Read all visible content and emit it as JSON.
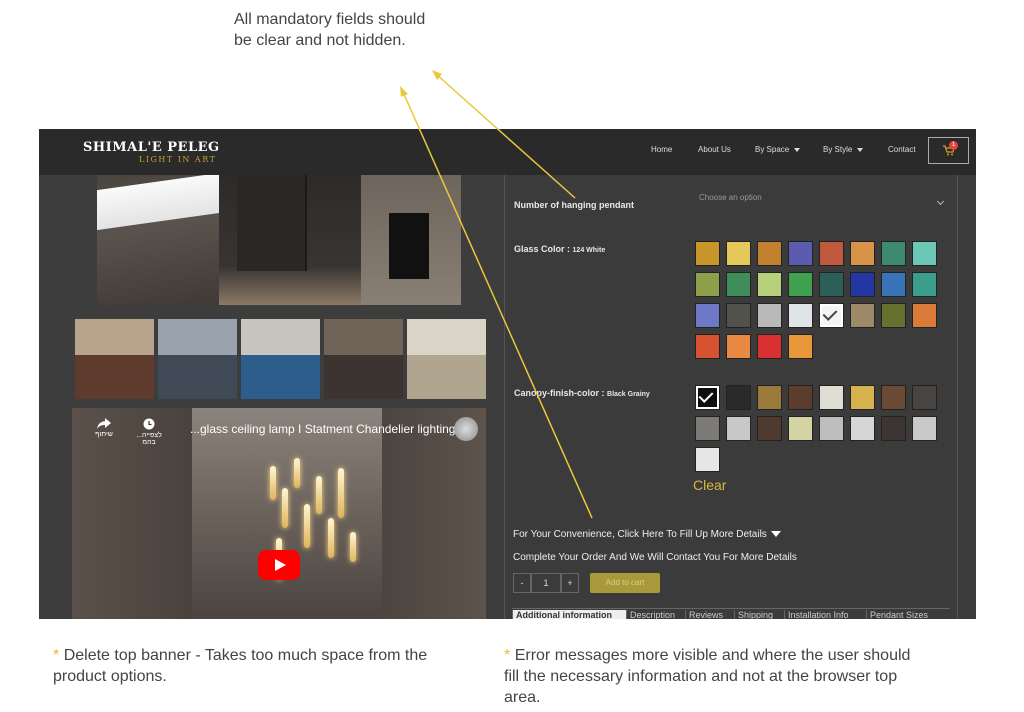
{
  "annotations": {
    "top_note": "All mandatory fields should be clear and not hidden.",
    "bottom_left_star": "*",
    "bottom_left_note": "Delete top banner - Takes too much space from the product options.",
    "bottom_right_star": "*",
    "bottom_right_note": "Error messages more visible and where the user should fill the necessary information and not at the browser top area."
  },
  "header": {
    "logo_main": "SHIMAL'E PELEG",
    "logo_sub": "LIGHT IN ART",
    "nav": [
      "Home",
      "About Us",
      "By Space",
      "By Style",
      "Contact"
    ],
    "cart_count": "1",
    "cart_icon": "shopping-cart-icon"
  },
  "video": {
    "share_label": "שיתוף",
    "watch_later_label": "...לצפייה בהמ",
    "title": "...glass ceiling lamp I Statment Chandelier lighting"
  },
  "options": {
    "pendant_label": "Number of hanging pendant",
    "pendant_placeholder": "Choose an option",
    "glass_label": "Glass Color :",
    "glass_value": "124 White",
    "canopy_label": "Canopy-finish-color :",
    "canopy_value": "Black Grainy",
    "clear": "Clear",
    "glass_colors": [
      "#c9962b",
      "#e4c95a",
      "#c2812f",
      "#5b5bb0",
      "#c1593e",
      "#d8934a",
      "#3d8a6e",
      "#6cc7b6",
      "#8ea04c",
      "#3f8d5a",
      "#b7d07c",
      "#3fa14f",
      "#2d5f5a",
      "#2336a1",
      "#3874b7",
      "#3c9c8d",
      "#6d79c6",
      "#52524c",
      "#b9b9b9",
      "#dfe5e7",
      "#f4f4f4",
      "#9d8a6b",
      "#66712f",
      "#db7b3a",
      "#d7532f",
      "#e88a43",
      "#d93131",
      "#e8973b"
    ],
    "glass_selected_index": 20,
    "canopy_colors": [
      "#0e0e0e",
      "#2a2a2a",
      "#9a7a3a",
      "#5a3d2c",
      "#e0ddd3",
      "#d7b24e",
      "#6b4a33",
      "#474441",
      "#7b7a77",
      "#c8c8c8",
      "#4f3a2f",
      "#d4d3a4",
      "#bdbdbd",
      "#d6d6d6",
      "#3c3533",
      "#c9c9c9",
      "#e6e6e6"
    ],
    "canopy_selected_index": 0
  },
  "order": {
    "convenience": "For Your Convenience, Click Here To Fill Up More Details",
    "complete": "Complete Your Order And We Will Contact You For More Details",
    "minus": "-",
    "qty": "1",
    "plus": "+",
    "add_to_cart": "Add to cart"
  },
  "tabs": [
    "Additional information",
    "Description",
    "Reviews",
    "Shipping",
    "Installation Info",
    "Pendant Sizes"
  ]
}
